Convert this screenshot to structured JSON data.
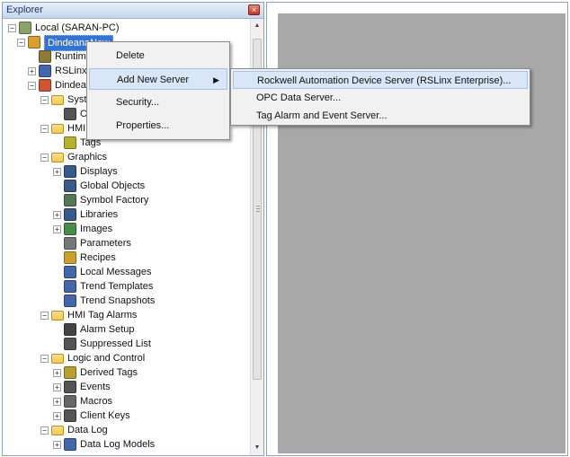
{
  "explorer": {
    "title": "Explorer",
    "close_glyph": "×",
    "tree": [
      {
        "label": "Local (SARAN-PC)",
        "icon": "computer-icon",
        "expander": "−",
        "level": 0
      },
      {
        "label": "DindeanaNew",
        "icon": "application-icon",
        "expander": "−",
        "level": 1,
        "selected": true
      },
      {
        "label": "Runtime Security",
        "icon": "key-icon",
        "expander": "",
        "level": 2
      },
      {
        "label": "RSLinx Enterprise",
        "icon": "network-icon",
        "expander": "+",
        "level": 2
      },
      {
        "label": "DindeanaNew",
        "icon": "hmi-server-icon",
        "expander": "−",
        "level": 2
      },
      {
        "label": "System",
        "icon": "folder-icon",
        "expander": "−",
        "level": 3
      },
      {
        "label": "Command Line",
        "icon": "command-icon",
        "expander": "",
        "level": 4
      },
      {
        "label": "HMI Tags",
        "icon": "folder-icon",
        "expander": "−",
        "level": 3
      },
      {
        "label": "Tags",
        "icon": "tags-icon",
        "expander": "",
        "level": 4
      },
      {
        "label": "Graphics",
        "icon": "folder-icon",
        "expander": "−",
        "level": 3
      },
      {
        "label": "Displays",
        "icon": "displays-icon",
        "expander": "+",
        "level": 4
      },
      {
        "label": "Global Objects",
        "icon": "global-objects-icon",
        "expander": "",
        "level": 4
      },
      {
        "label": "Symbol Factory",
        "icon": "symbol-factory-icon",
        "expander": "",
        "level": 4
      },
      {
        "label": "Libraries",
        "icon": "libraries-icon",
        "expander": "+",
        "level": 4
      },
      {
        "label": "Images",
        "icon": "images-icon",
        "expander": "+",
        "level": 4
      },
      {
        "label": "Parameters",
        "icon": "parameters-icon",
        "expander": "",
        "level": 4
      },
      {
        "label": "Recipes",
        "icon": "recipes-icon",
        "expander": "",
        "level": 4
      },
      {
        "label": "Local Messages",
        "icon": "local-messages-icon",
        "expander": "",
        "level": 4
      },
      {
        "label": "Trend Templates",
        "icon": "trend-templates-icon",
        "expander": "",
        "level": 4
      },
      {
        "label": "Trend Snapshots",
        "icon": "trend-snapshots-icon",
        "expander": "",
        "level": 4
      },
      {
        "label": "HMI Tag Alarms",
        "icon": "folder-icon",
        "expander": "−",
        "level": 3
      },
      {
        "label": "Alarm Setup",
        "icon": "alarm-setup-icon",
        "expander": "",
        "level": 4
      },
      {
        "label": "Suppressed List",
        "icon": "suppressed-list-icon",
        "expander": "",
        "level": 4
      },
      {
        "label": "Logic and Control",
        "icon": "folder-icon",
        "expander": "−",
        "level": 3
      },
      {
        "label": "Derived Tags",
        "icon": "derived-tags-icon",
        "expander": "+",
        "level": 4
      },
      {
        "label": "Events",
        "icon": "events-icon",
        "expander": "+",
        "level": 4
      },
      {
        "label": "Macros",
        "icon": "macros-icon",
        "expander": "+",
        "level": 4
      },
      {
        "label": "Client Keys",
        "icon": "client-keys-icon",
        "expander": "+",
        "level": 4
      },
      {
        "label": "Data Log",
        "icon": "folder-icon",
        "expander": "−",
        "level": 3
      },
      {
        "label": "Data Log Models",
        "icon": "data-log-models-icon",
        "expander": "+",
        "level": 4
      }
    ]
  },
  "context_menu": {
    "items": [
      {
        "label": "Delete",
        "submenu": false
      },
      {
        "label": "Add New Server",
        "submenu": true,
        "hover": true
      },
      {
        "label": "Security...",
        "submenu": false
      },
      {
        "label": "Properties...",
        "submenu": false
      }
    ],
    "submenu_arrow": "▶"
  },
  "submenu": {
    "items": [
      {
        "label": "Rockwell Automation Device Server (RSLinx Enterprise)...",
        "hover": true
      },
      {
        "label": "OPC Data Server..."
      },
      {
        "label": "Tag Alarm and Event Server..."
      }
    ]
  },
  "scrollbar": {
    "up": "▲",
    "down": "▼"
  },
  "colors": {
    "selection": "#3174d6",
    "workspace": "#a8a8a8",
    "menu_hover": "#d9e6f7"
  }
}
